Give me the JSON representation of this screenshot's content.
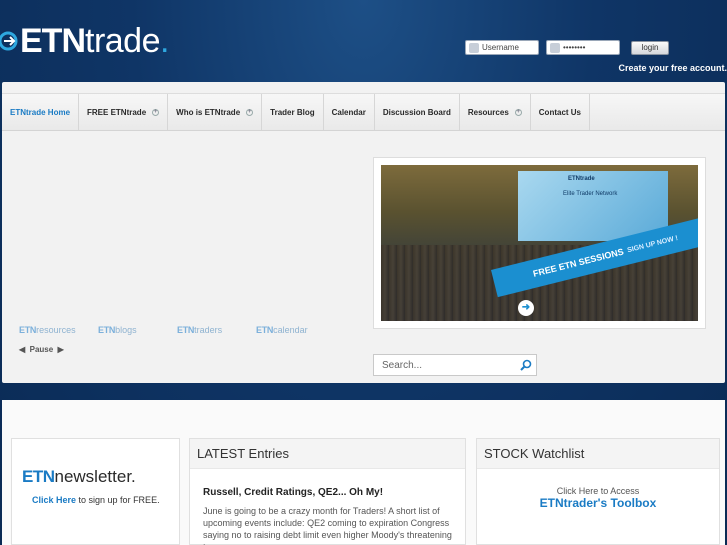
{
  "header": {
    "logo_etn": "ETN",
    "logo_trade": "trade",
    "logo_dot": ".",
    "username_placeholder": "Username",
    "password_mask": "••••••••",
    "login_label": "login",
    "create_account": "Create your free account."
  },
  "nav": {
    "items": [
      {
        "label": "ETNtrade Home",
        "dropdown": false
      },
      {
        "label": "FREE ETNtrade",
        "dropdown": true
      },
      {
        "label": "Who is ETNtrade",
        "dropdown": true
      },
      {
        "label": "Trader Blog",
        "dropdown": false
      },
      {
        "label": "Calendar",
        "dropdown": false
      },
      {
        "label": "Discussion Board",
        "dropdown": false
      },
      {
        "label": "Resources",
        "dropdown": true
      },
      {
        "label": "Contact Us",
        "dropdown": false
      }
    ]
  },
  "shortcuts": [
    {
      "brand": "ETN",
      "suffix": "resources"
    },
    {
      "brand": "ETN",
      "suffix": "blogs"
    },
    {
      "brand": "ETN",
      "suffix": "traders"
    },
    {
      "brand": "ETN",
      "suffix": "calendar"
    }
  ],
  "slider": {
    "pause_label": "Pause",
    "banner_brand": "ETNtrade",
    "banner_screen_sub": "Elite Trader Network",
    "banner_cta_main": "FREE ETN SESSIONS",
    "banner_cta_sub": "SIGN UP NOW !"
  },
  "search": {
    "placeholder": "Search..."
  },
  "newsletter": {
    "brand": "ETN",
    "title_rest": "newsletter.",
    "link": "Click Here",
    "text": " to sign up for FREE."
  },
  "latest": {
    "heading": "LATEST Entries",
    "entry_title": "Russell, Credit Ratings, QE2... Oh My!",
    "entry_text": "June is going to be a crazy month for Traders!  A short list of upcoming events include: QE2 coming to expiration Congress saying no to raising debt limit even higher Moody's threatening to..."
  },
  "watchlist": {
    "heading": "STOCK Watchlist",
    "text": "Click Here to Access",
    "link": "ETNtrader's Toolbox"
  },
  "colors": {
    "accent": "#1a7bc4",
    "header_bg": "#0f3566"
  }
}
